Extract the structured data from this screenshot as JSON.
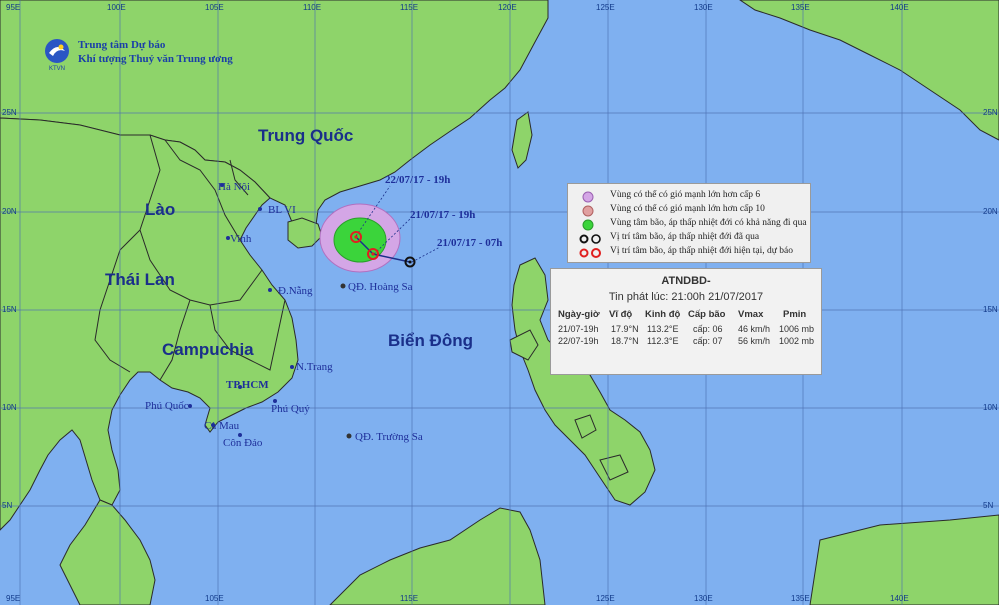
{
  "map": {
    "colors": {
      "sea": "#7fb0f0",
      "land": "#8ed46a",
      "border": "#222222",
      "grid": "#4c6fb0",
      "risk_zone": "#d4a6e6",
      "center_zone": "#3bd43b",
      "track": "#1a2f8a"
    },
    "top_lon_labels": [
      "95E",
      "100E",
      "105E",
      "110E",
      "115E",
      "120E",
      "125E",
      "130E",
      "135E",
      "140E"
    ],
    "bottom_lon_labels": [
      "95E",
      "105E",
      "115E",
      "125E",
      "130E",
      "135E",
      "140E"
    ],
    "lat_labels_left": [
      "25N",
      "20N",
      "15N",
      "10N",
      "5N"
    ],
    "lat_labels_right": [
      "25N",
      "20N",
      "15N",
      "10N",
      "5N"
    ]
  },
  "organization": {
    "line1": "Trung tâm Dự báo",
    "line2": "Khí tượng Thuỷ văn Trung ương",
    "logo_text": "KTVN"
  },
  "regions": {
    "china": "Trung Quốc",
    "laos": "Lào",
    "thailand": "Thái Lan",
    "cambodia": "Campuchia",
    "east_sea": "Biển Đông"
  },
  "places": {
    "hanoi": "Hà Nội",
    "bach_long_vi": "BL VI",
    "vinh": "Vinh",
    "da_nang": "Đ.Nẵng",
    "hoang_sa": "QĐ. Hoàng Sa",
    "nha_trang": "N.Trang",
    "hcm": "TP.HCM",
    "phu_quoc": "Phú Quốc",
    "phu_quy": "Phú Quý",
    "ca_mau": "Cà Mau",
    "con_dao": "Côn Đảo",
    "truong_sa": "QĐ. Trường Sa"
  },
  "track": {
    "point_label_1": "21/07/17 - 07h",
    "point_label_2": "21/07/17 - 19h",
    "point_label_3": "22/07/17 - 19h"
  },
  "legend": {
    "items": [
      {
        "text": "Vùng có thể có gió mạnh lớn hơn cấp 6",
        "symbol": "purple-circle-icon"
      },
      {
        "text": "Vùng có thể có gió mạnh lớn hơn cấp 10",
        "symbol": "red-circle-icon"
      },
      {
        "text": "Vùng tâm bão, áp thấp nhiệt đới có khả năng đi qua",
        "symbol": "green-circle-icon"
      },
      {
        "text": "Vị trí tâm bão, áp thấp nhiệt đới đã qua",
        "symbol": "black-storm-icon"
      },
      {
        "text": "Vị trí tâm bão, áp thấp nhiệt đới hiện tại, dự báo",
        "symbol": "red-storm-icon"
      }
    ]
  },
  "bulletin": {
    "title": "ATNDBD-",
    "issued": "Tin phát lúc: 21:00h 21/07/2017",
    "headers": [
      "Ngày-giờ",
      "Vĩ độ",
      "Kinh độ",
      "Cấp bão",
      "Vmax",
      "Pmin"
    ],
    "rows": [
      [
        "21/07-19h",
        "17.9°N",
        "113.2°E",
        "cấp: 06",
        "46 km/h",
        "1006 mb"
      ],
      [
        "22/07-19h",
        "18.7°N",
        "112.3°E",
        "cấp: 07",
        "56 km/h",
        "1002 mb"
      ]
    ]
  }
}
